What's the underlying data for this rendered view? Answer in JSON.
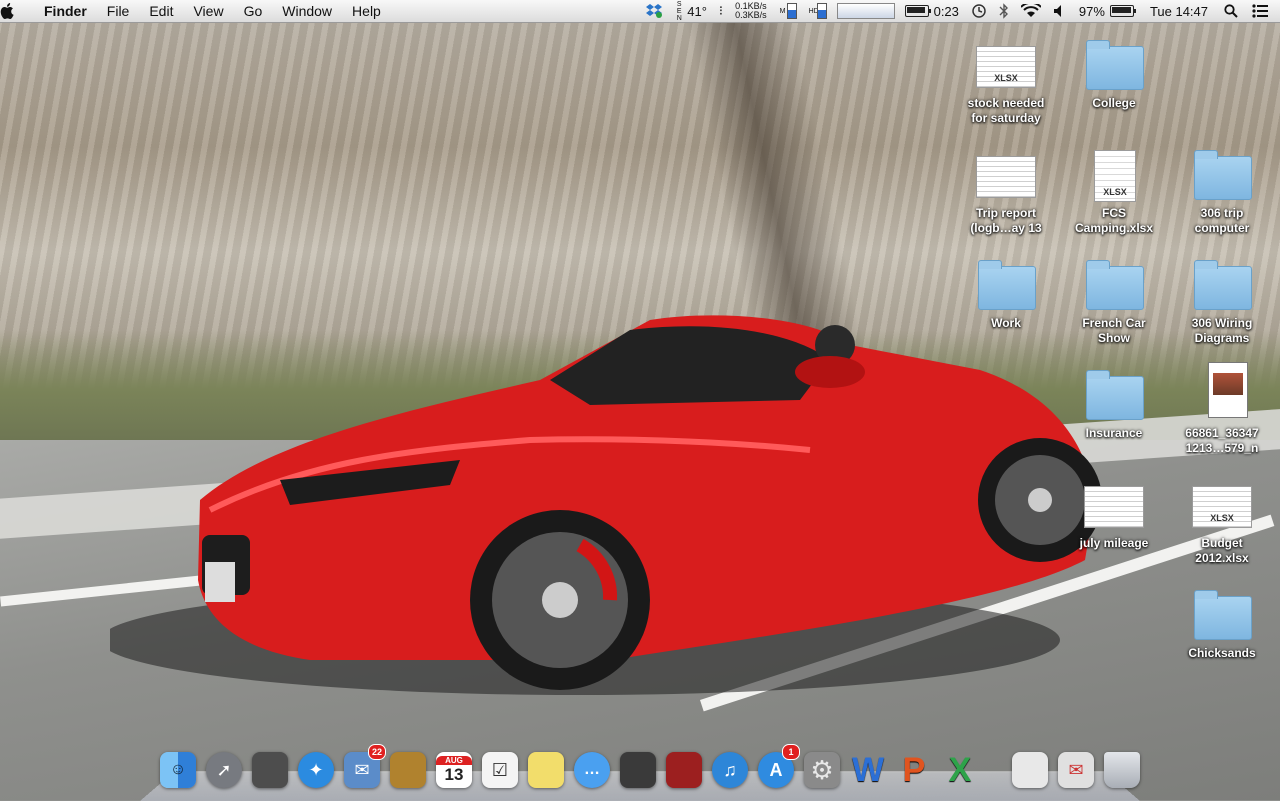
{
  "menubar": {
    "apple_menu": "",
    "app_name": "Finder",
    "menus": [
      "File",
      "Edit",
      "View",
      "Go",
      "Window",
      "Help"
    ],
    "weather_temp": "41°",
    "net_up": "0.1KB/s",
    "net_down": "0.3KB/s",
    "mem_label": "M",
    "hd_label": "HD",
    "battery_time": "0:23",
    "battery_percent": "97%",
    "clock": "Tue 14:47",
    "battery_level": 0.97
  },
  "desktop": {
    "icons": [
      {
        "label": "stock needed\nfor saturday",
        "kind": "xlsx-doc",
        "tag": "XLSX"
      },
      {
        "label": "College",
        "kind": "folder"
      },
      {
        "label": "Trip report\n(logb…ay 13",
        "kind": "sheet"
      },
      {
        "label": "FCS\nCamping.xlsx",
        "kind": "xlsx-doc",
        "tag": "XLSX"
      },
      {
        "label": "306 trip\ncomputer",
        "kind": "folder"
      },
      {
        "label": "Work",
        "kind": "folder"
      },
      {
        "label": "French Car\nShow",
        "kind": "folder"
      },
      {
        "label": "306 Wiring\nDiagrams",
        "kind": "folder"
      },
      {
        "label": "Insurance",
        "kind": "folder"
      },
      {
        "label": "66861_36347\n1213…579_n",
        "kind": "photo"
      },
      {
        "label": "july mileage",
        "kind": "sheet"
      },
      {
        "label": "Budget\n2012.xlsx",
        "kind": "xlsx-doc",
        "tag": "XLSX"
      },
      {
        "label": "Chicksands",
        "kind": "folder"
      }
    ]
  },
  "dock": {
    "items": [
      {
        "name": "Finder",
        "icon": "finder-icon",
        "color": "#3a8ee6"
      },
      {
        "name": "Launchpad",
        "icon": "rocket-icon",
        "color": "#777a80"
      },
      {
        "name": "Image Capture",
        "icon": "image-capture-icon",
        "color": "#4d4d4d"
      },
      {
        "name": "Safari",
        "icon": "compass-icon",
        "color": "#2b8be0"
      },
      {
        "name": "Mail",
        "icon": "mail-icon",
        "color": "#5b8cc9",
        "badge": "22"
      },
      {
        "name": "Contacts",
        "icon": "address-book-icon",
        "color": "#b0822e"
      },
      {
        "name": "Calendar",
        "icon": "calendar-icon",
        "color": "#ffffff",
        "text": "13",
        "month": "AUG"
      },
      {
        "name": "Reminders",
        "icon": "checklist-icon",
        "color": "#f4f4f4"
      },
      {
        "name": "Stickies",
        "icon": "note-icon",
        "color": "#f2dd6b"
      },
      {
        "name": "Messages",
        "icon": "speech-bubble-icon",
        "color": "#4aa0f0"
      },
      {
        "name": "FaceTime",
        "icon": "camera-icon",
        "color": "#3a3a3a"
      },
      {
        "name": "Photo Booth",
        "icon": "photo-booth-icon",
        "color": "#9c1f1f"
      },
      {
        "name": "iTunes",
        "icon": "music-note-icon",
        "color": "#2d86d8"
      },
      {
        "name": "App Store",
        "icon": "app-store-icon",
        "color": "#2f8be0",
        "badge": "1"
      },
      {
        "name": "System Preferences",
        "icon": "gear-icon",
        "color": "#8a8a8a"
      },
      {
        "name": "Word",
        "icon": "word-icon",
        "color": "#2b6fd6",
        "text": "W"
      },
      {
        "name": "PowerPoint",
        "icon": "powerpoint-icon",
        "color": "#e0541f",
        "text": "P"
      },
      {
        "name": "Excel",
        "icon": "excel-icon",
        "color": "#2ea34a",
        "text": "X"
      },
      {
        "name": "Preview",
        "icon": "document-icon",
        "color": "#e8e8e8"
      },
      {
        "name": "Mail Inbox",
        "icon": "envelope-icon",
        "color": "#e0e0e0"
      },
      {
        "name": "Trash",
        "icon": "trash-icon",
        "color": "#c8ccd2"
      }
    ]
  }
}
